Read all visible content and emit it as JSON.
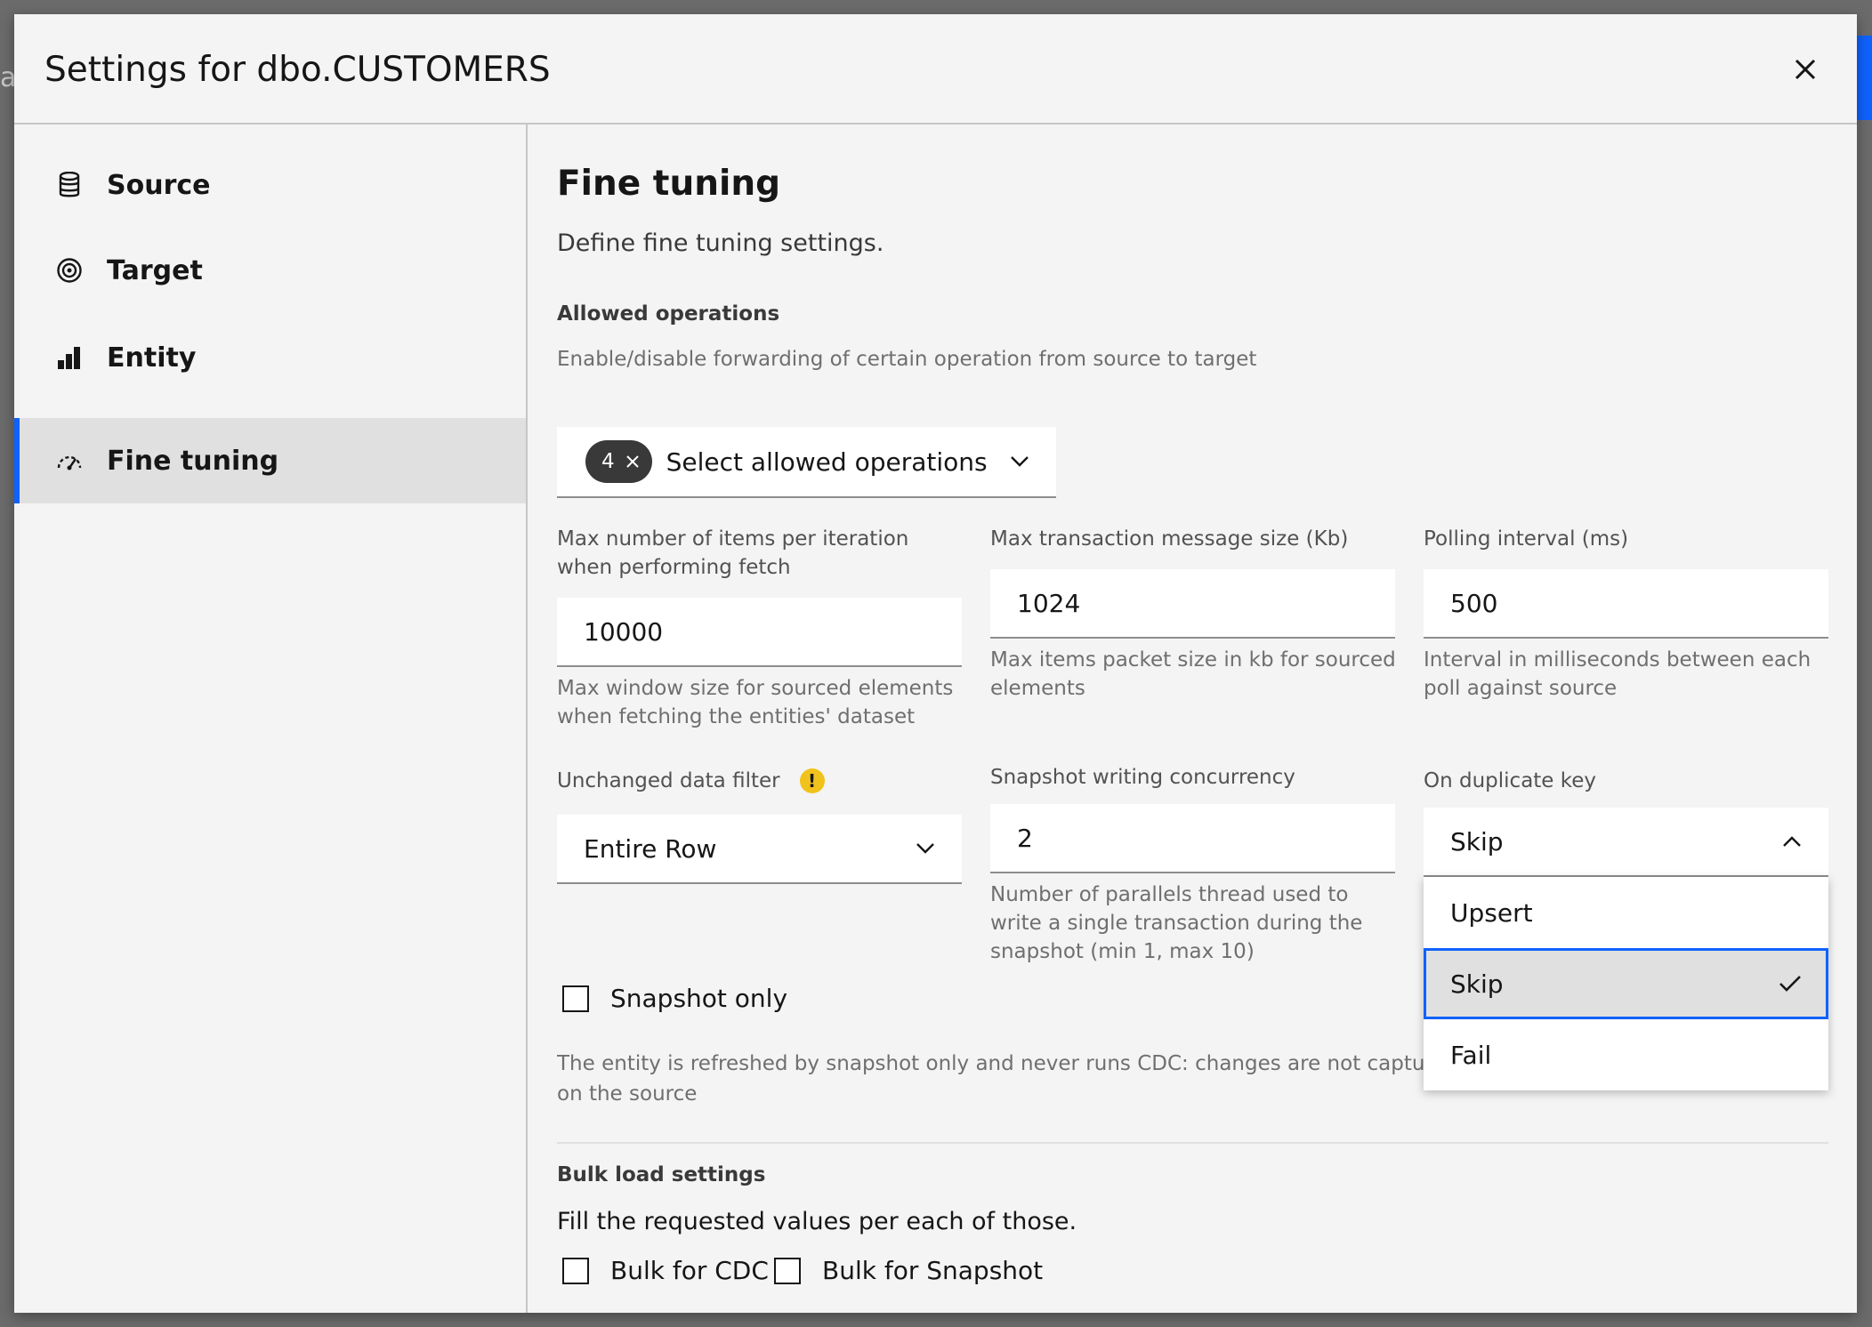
{
  "modal": {
    "title": "Settings for dbo.CUSTOMERS"
  },
  "sidebar": {
    "items": [
      {
        "label": "Source",
        "icon": "database-icon"
      },
      {
        "label": "Target",
        "icon": "target-icon"
      },
      {
        "label": "Entity",
        "icon": "bar-chart-icon"
      },
      {
        "label": "Fine tuning",
        "icon": "dashboard-gauge-icon",
        "active": true
      }
    ]
  },
  "main": {
    "title": "Fine tuning",
    "description": "Define fine tuning settings.",
    "allowed_ops": {
      "label": "Allowed operations",
      "helper": "Enable/disable forwarding of certain operation from source to target",
      "count": "4",
      "placeholder": "Select allowed operations"
    },
    "max_items": {
      "label": "Max number of items per iteration when performing fetch",
      "value": "10000",
      "helper": "Max window size for sourced elements when fetching the entities' dataset"
    },
    "max_tx_size": {
      "label": "Max transaction message size (Kb)",
      "value": "1024",
      "helper": "Max items packet size in kb for sourced elements"
    },
    "polling": {
      "label": "Polling interval (ms)",
      "value": "500",
      "helper": "Interval in milliseconds between each poll against source"
    },
    "unchanged_filter": {
      "label": "Unchanged data filter",
      "value": "Entire Row"
    },
    "snapshot_concurrency": {
      "label": "Snapshot writing concurrency",
      "value": "2",
      "helper": "Number of parallels thread used to write a single transaction during the snapshot (min 1, max 10)"
    },
    "on_duplicate": {
      "label": "On duplicate key",
      "value": "Skip",
      "options": [
        "Upsert",
        "Skip",
        "Fail"
      ],
      "selected_option": "Skip"
    },
    "snapshot_only": {
      "label": "Snapshot only",
      "helper_line1": "The entity is refreshed by snapshot only and never runs CDC: changes are not captured and",
      "helper_line2": "on the source"
    },
    "bulk": {
      "label": "Bulk load settings",
      "description": "Fill the requested values per each of those.",
      "cdc_label": "Bulk for CDC",
      "snapshot_label": "Bulk for Snapshot"
    }
  },
  "colors": {
    "accent": "#0f62fe",
    "warning": "#f1c21b",
    "tag_bg": "#393939"
  }
}
